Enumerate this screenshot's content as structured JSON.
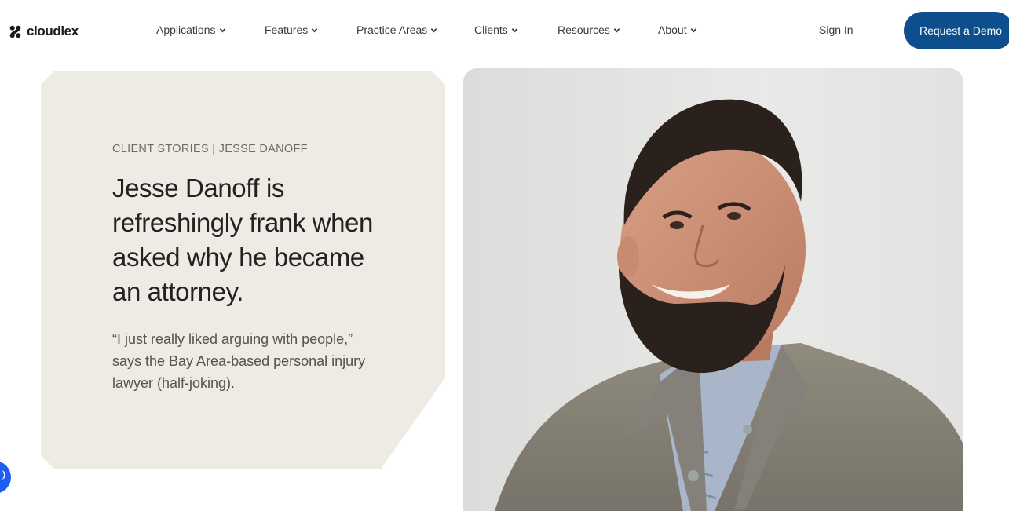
{
  "header": {
    "logo_text": "cloudlex",
    "nav": [
      {
        "label": "Applications"
      },
      {
        "label": "Features"
      },
      {
        "label": "Practice Areas"
      },
      {
        "label": "Clients"
      },
      {
        "label": "Resources"
      },
      {
        "label": "About"
      }
    ],
    "sign_in": "Sign In",
    "cta": "Request a Demo"
  },
  "story": {
    "eyebrow": "CLIENT STORIES | JESSE DANOFF",
    "headline": "Jesse Danoff is refreshingly frank when asked why he became an attorney.",
    "quote": "“I just really liked arguing with people,” says the Bay Area-based personal injury lawyer (half-joking)."
  },
  "colors": {
    "brand_blue": "#0c4f8c",
    "card_bg": "#eeebe4",
    "chat_blue": "#1f5ef5"
  }
}
